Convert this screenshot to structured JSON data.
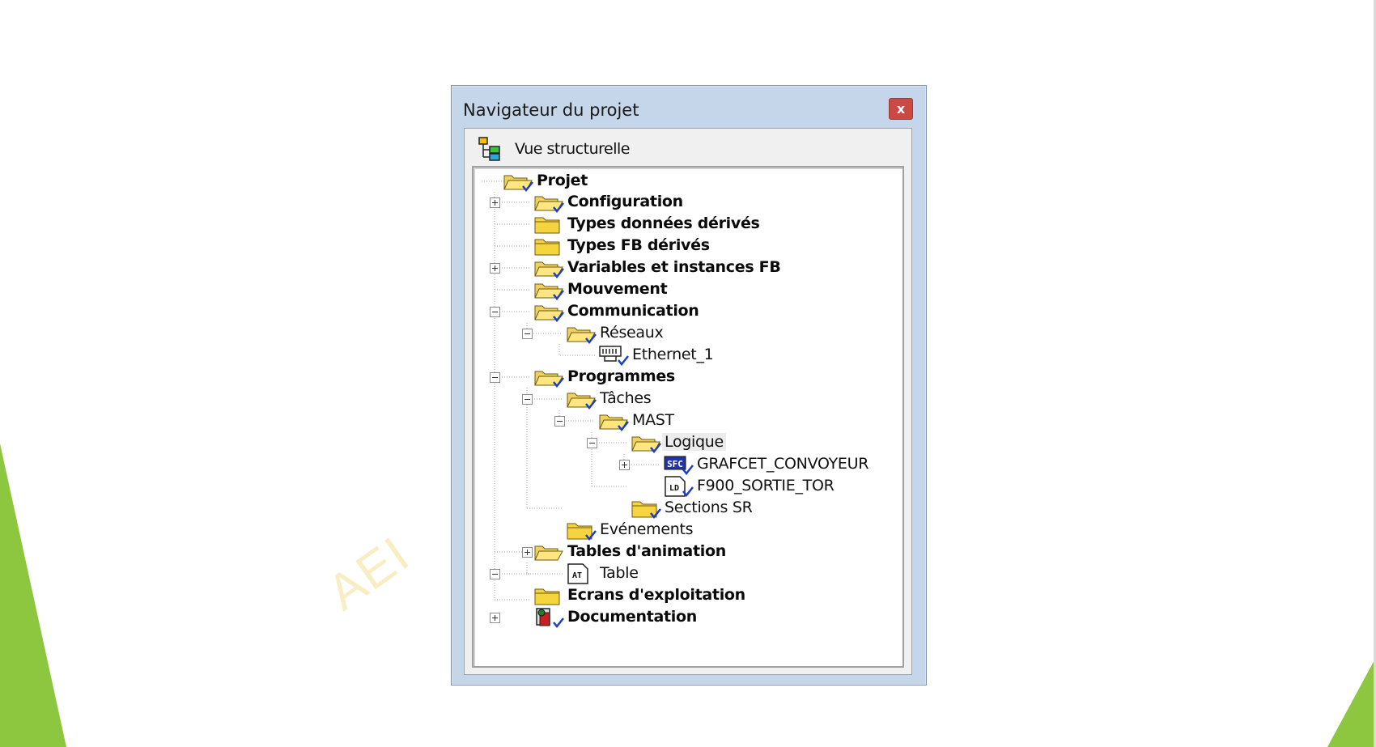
{
  "window": {
    "title": "Navigateur du projet",
    "close_label": "x"
  },
  "view": {
    "label": "Vue structurelle"
  },
  "watermark": "AEI",
  "colors": {
    "accent_green": "#8dc63f",
    "close_red": "#c74a45",
    "check_blue": "#1a3fc4"
  },
  "tree": {
    "projet": "Projet",
    "configuration": "Configuration",
    "types_donnees": "Types données dérivés",
    "types_fb": "Types FB dérivés",
    "variables": "Variables et instances FB",
    "mouvement": "Mouvement",
    "communication": "Communication",
    "reseaux": "Réseaux",
    "ethernet": "Ethernet_1",
    "programmes": "Programmes",
    "taches": "Tâches",
    "mast": "MAST",
    "logique": "Logique",
    "grafcet": "GRAFCET_CONVOYEUR",
    "f900": "F900_SORTIE_TOR",
    "sections_sr": "Sections SR",
    "evenements": "Evénements",
    "tables_animation": "Tables d'animation",
    "table": "Table",
    "ecrans": "Ecrans d'exploitation",
    "documentation": "Documentation"
  },
  "icons": {
    "sfc_tag": "SFC",
    "ld_tag": "LD",
    "at_tag": "AT"
  }
}
